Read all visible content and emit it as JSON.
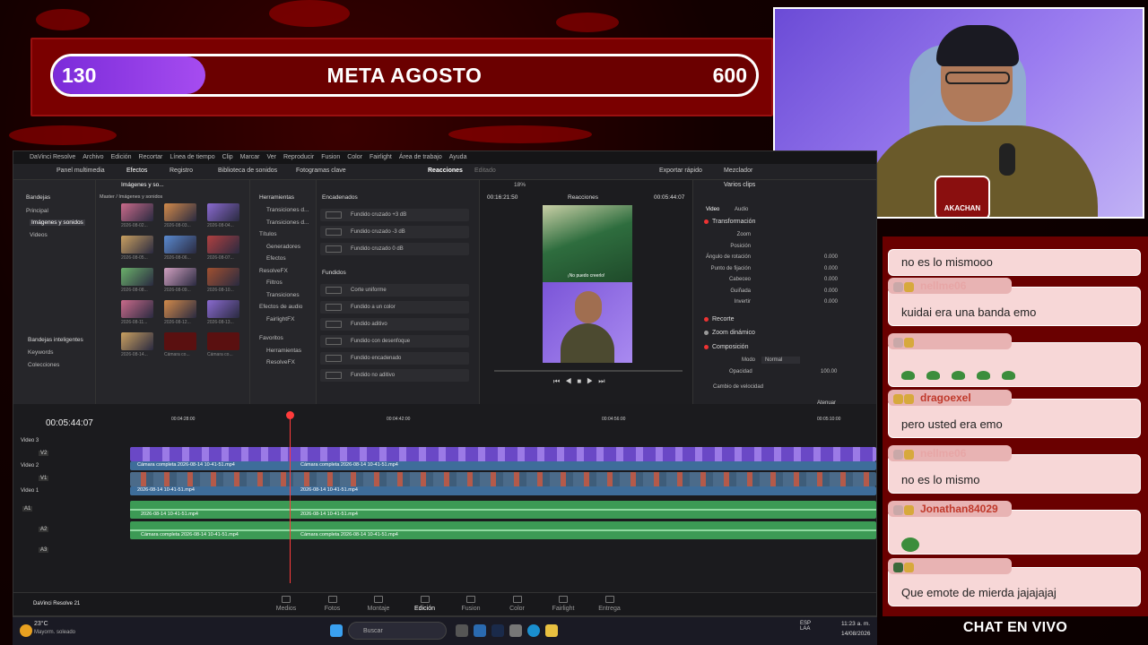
{
  "goal": {
    "current": "130",
    "title": "META AGOSTO",
    "target": "600",
    "progress_fraction": 0.217
  },
  "cam": {
    "badge_text": "AKACHAN"
  },
  "resolve": {
    "menu": [
      "DaVinci Resolve",
      "Archivo",
      "Edición",
      "Recortar",
      "Línea de tiempo",
      "Clip",
      "Marcar",
      "Ver",
      "Reproducir",
      "Fusion",
      "Color",
      "Fairlight",
      "Área de trabajo",
      "Ayuda"
    ],
    "toolbar": {
      "media_pool": "Panel multimedia",
      "effects": "Efectos",
      "index": "Registro",
      "sound_lib": "Biblioteca de sonidos",
      "keyframes": "Fotogramas clave",
      "project": "Reacciones",
      "status": "Editado",
      "quick_export": "Exportar rápido",
      "mixer": "Mezclador"
    },
    "bins": {
      "header": "Bandejas",
      "master_path": "Master / Imágenes y sonidos",
      "items": [
        "Principal",
        "Imágenes y sonidos",
        "Videos"
      ],
      "smart": "Bandejas inteligentes",
      "smart_items": [
        "Keywords",
        "Colecciones"
      ],
      "pool_label": "Imágenes y so...",
      "thumbs": [
        "2026-08-02...",
        "2026-08-03...",
        "2026-08-04...",
        "2026-08-05...",
        "2026-08-06...",
        "2026-08-07...",
        "2026-08-08...",
        "2026-08-09...",
        "2026-08-10...",
        "2026-08-11...",
        "2026-08-12...",
        "2026-08-13...",
        "2026-08-14...",
        "Cámara co...",
        "Cámara co..."
      ]
    },
    "tools": {
      "header": "Herramientas",
      "items": [
        "Transiciones d...",
        "Transiciones d...",
        "Títulos",
        "Generadores",
        "Efectos",
        "ResolveFX",
        "Filtros",
        "Transiciones",
        "Efectos de audio",
        "FairlightFX",
        "Favoritos",
        "Herramientas",
        "ResolveFX"
      ]
    },
    "fx": {
      "section1": "Encadenados",
      "list1": [
        "Fundido cruzado +3 dB",
        "Fundido cruzado -3 dB",
        "Fundido cruzado 0 dB"
      ],
      "section2": "Fundidos",
      "list2": [
        "Corte uniforme",
        "Fundido a un color",
        "Fundido aditivo",
        "Fundido con desenfoque",
        "Fundido encadenado",
        "Fundido no aditivo"
      ]
    },
    "viewer": {
      "timecode": "00:16:21:50",
      "zoom": "18%",
      "title": "Reacciones",
      "duration": "00:05:44:07",
      "caption": "¡No puedo creerlo!"
    },
    "inspector": {
      "title": "Varios clips",
      "tabs": [
        "Video",
        "Audio"
      ],
      "transform": "Transformación",
      "rows": [
        "Zoom",
        "Posición",
        "Ángulo de rotación",
        "Punto de fijación",
        "Cabeceo",
        "Guiñada",
        "Invertir"
      ],
      "values": [
        "0.000",
        "0.000",
        "0.000",
        "0.000",
        "0.000"
      ],
      "crop": "Recorte",
      "dyn_zoom": "Zoom dinámico",
      "composite": "Composición",
      "mode_label": "Modo",
      "mode_value": "Normal",
      "opacity_label": "Opacidad",
      "opacity_value": "100.00",
      "speed": "Cambio de velocidad"
    },
    "timeline": {
      "timecode": "00:05:44:07",
      "ruler": [
        "00:04:28:00",
        "00:04:42:00",
        "00:04:56:00",
        "00:05:10:00"
      ],
      "tracks": [
        "Video 3",
        "Video 2",
        "Video 1"
      ],
      "v2": "V2",
      "v1": "V1",
      "a1": "A1",
      "a2": "A2",
      "a3": "A3",
      "clip_cam": "Cámara completa 2026-08-14 10-41-51.mp4",
      "clip_screen": "2026-08-14 10-41-51.mp4",
      "atten": "Atenuar"
    },
    "pages": [
      "Medios",
      "Fotos",
      "Montaje",
      "Edición",
      "Fusion",
      "Color",
      "Fairlight",
      "Entrega"
    ],
    "brand": "DaVinci Resolve 21"
  },
  "taskbar": {
    "weather_temp": "23°C",
    "weather_desc": "Mayorm. soleado",
    "search": "Buscar",
    "lang": "ESP LAA",
    "time": "11:23 a. m.",
    "date": "14/08/2026"
  },
  "chat": {
    "messages": [
      {
        "user": "",
        "text": "no es lo mismooo"
      },
      {
        "user": "nellme06",
        "text": "kuidai era una banda emo"
      },
      {
        "user": "",
        "text": ""
      },
      {
        "user": "dragoexel",
        "text": "pero usted era emo"
      },
      {
        "user": "nellme06",
        "text": "no es lo mismo"
      },
      {
        "user": "Jonathan84029",
        "text": ""
      },
      {
        "user": "",
        "text": "Que emote de mierda jajajajaj"
      }
    ],
    "title": "CHAT EN VIVO"
  },
  "colors": {
    "accent": "#a64cf0",
    "chat_bg": "#6a0000",
    "video_track": "#3e6d9a",
    "audio_track": "#3c9a55",
    "playhead": "#ff3b3b"
  }
}
